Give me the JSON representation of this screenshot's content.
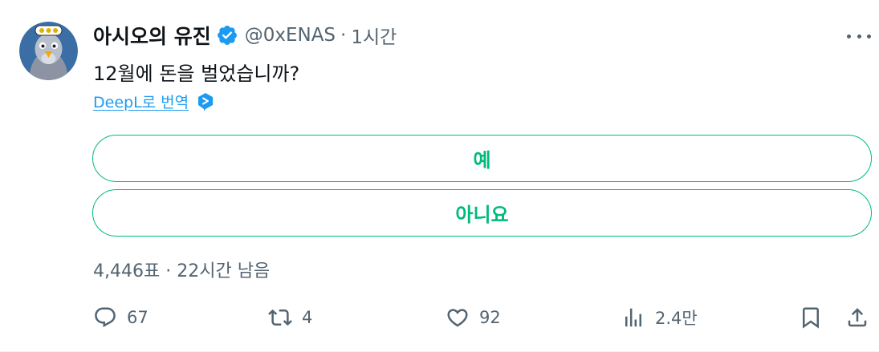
{
  "tweet": {
    "author": {
      "display_name": "아시오의 유진",
      "handle": "@0xENAS",
      "avatar": "pigeon-avatar",
      "verified": true,
      "verified_color": "#1d9bf0"
    },
    "separator": "·",
    "time": "1시간",
    "text": "12월에 돈을 벌었습니까?",
    "translate_label": "DeepL로 번역",
    "poll": {
      "accent": "#00ba7c",
      "options": [
        {
          "label": "예"
        },
        {
          "label": "아니요"
        }
      ],
      "votes": "4,446표",
      "separator": "·",
      "remaining": "22시간 남음"
    },
    "actions": {
      "reply": {
        "icon": "reply-icon",
        "count": "67"
      },
      "retweet": {
        "icon": "retweet-icon",
        "count": "4"
      },
      "like": {
        "icon": "heart-icon",
        "count": "92"
      },
      "views": {
        "icon": "views-chart-icon",
        "count": "2.4만"
      },
      "bookmark": {
        "icon": "bookmark-icon"
      },
      "share": {
        "icon": "share-icon"
      }
    }
  }
}
